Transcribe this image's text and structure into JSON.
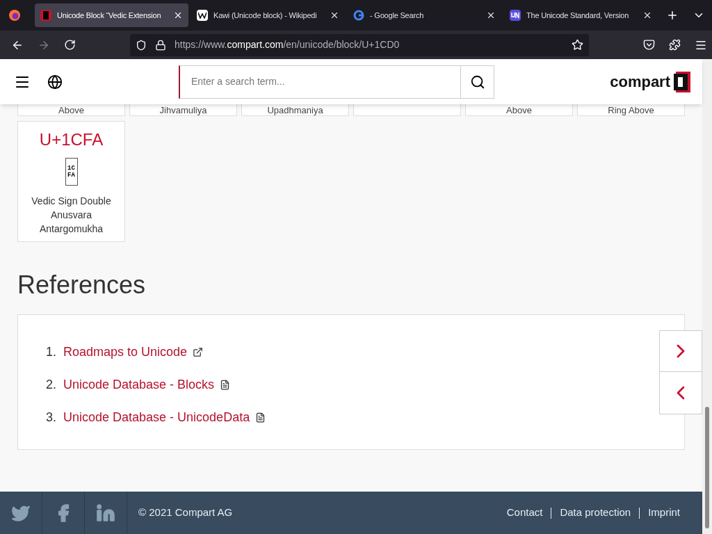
{
  "browser": {
    "tabs": [
      {
        "title": "Unicode Block “Vedic Extension",
        "selected": true
      },
      {
        "title": "Kawi (Unicode block) - Wikipedi",
        "selected": false
      },
      {
        "title": "- Google Search",
        "selected": false
      },
      {
        "title": "The Unicode Standard, Version",
        "selected": false
      }
    ],
    "url_prefix": "https://www.",
    "url_domain": "compart.com",
    "url_path": "/en/unicode/block/U+1CD0"
  },
  "header": {
    "search_placeholder": "Enter a search term...",
    "logo": "compart"
  },
  "cut_cards": [
    {
      "kind": "named",
      "name": "Above"
    },
    {
      "kind": "named",
      "name": "Jihvamuliya"
    },
    {
      "kind": "named",
      "name": "Upadhmaniya"
    },
    {
      "kind": "blank"
    },
    {
      "kind": "named",
      "name": "Above"
    },
    {
      "kind": "named",
      "name": "Ring Above"
    }
  ],
  "card": {
    "code": "U+1CFA",
    "glyph_top": "1C",
    "glyph_bottom": "FA",
    "name": "Vedic Sign Double Anusvara Antargomukha"
  },
  "references": {
    "title": "References",
    "items": [
      {
        "number": "1.",
        "label": "Roadmaps to Unicode",
        "kind": "external"
      },
      {
        "number": "2.",
        "label": "Unicode Database - Blocks",
        "kind": "file"
      },
      {
        "number": "3.",
        "label": "Unicode Database - UnicodeData",
        "kind": "file"
      }
    ]
  },
  "footer": {
    "copyright": "© 2021 Compart AG",
    "links": [
      "Contact",
      "Data protection",
      "Imprint"
    ]
  }
}
